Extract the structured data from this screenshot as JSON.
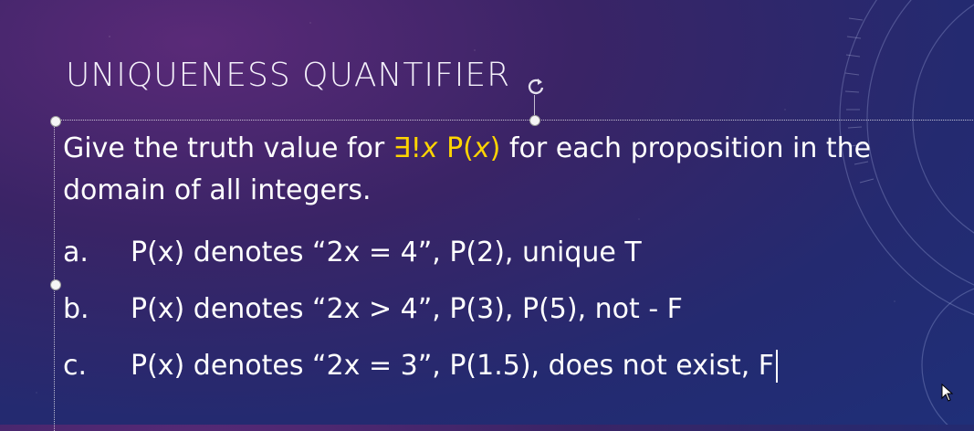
{
  "slide": {
    "title": "UNIQUENESS QUANTIFIER",
    "intro": {
      "before": "Give the truth value for ",
      "quantifier": "∃!",
      "var1": "x",
      "pred": " P(",
      "var2": "x",
      "close": ")",
      "after": " for each proposition in the domain of all integers."
    },
    "items": [
      {
        "marker": "a.",
        "text": "P(x) denotes “2x = 4”, P(2), unique T"
      },
      {
        "marker": "b.",
        "text": "P(x) denotes “2x > 4”, P(3), P(5), not - F"
      },
      {
        "marker": "c.",
        "text": "P(x) denotes “2x = 3”, P(1.5), does not exist, F"
      }
    ]
  },
  "colors": {
    "highlight": "#ffd400",
    "text": "#ffffff"
  },
  "icons": {
    "rotate": "rotate-handle-icon",
    "pointer": "mouse-pointer-icon"
  }
}
